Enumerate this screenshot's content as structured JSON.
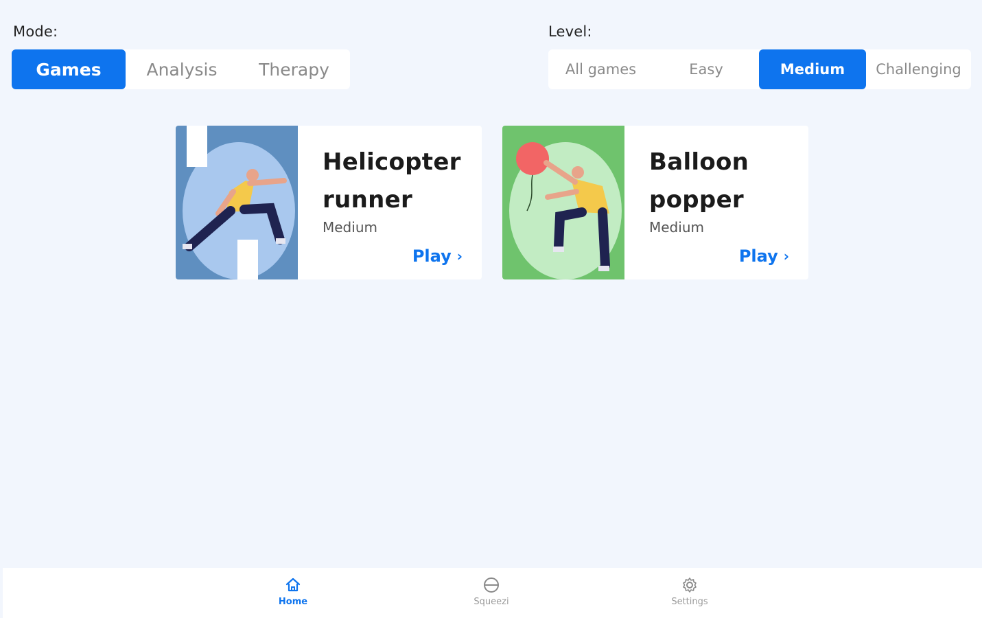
{
  "mode": {
    "label": "Mode:",
    "options": [
      "Games",
      "Analysis",
      "Therapy"
    ],
    "selected": "Games"
  },
  "level": {
    "label": "Level:",
    "options": [
      "All games",
      "Easy",
      "Medium",
      "Challenging"
    ],
    "selected": "Medium"
  },
  "games": [
    {
      "title_line1": "Helicopter",
      "title_line2": "runner",
      "level": "Medium",
      "play_label": "Play",
      "art_bg": "#5f8fc0",
      "art_blob": "#a9c8ee"
    },
    {
      "title_line1": "Balloon",
      "title_line2": "popper",
      "level": "Medium",
      "play_label": "Play",
      "art_bg": "#6fc36d",
      "art_blob": "#c2ecc3"
    }
  ],
  "nav": {
    "items": [
      {
        "label": "Home",
        "icon": "home-icon",
        "active": true
      },
      {
        "label": "Squeezi",
        "icon": "squeezi-icon",
        "active": false
      },
      {
        "label": "Settings",
        "icon": "gear-icon",
        "active": false
      }
    ]
  },
  "colors": {
    "accent": "#0e74ee",
    "background": "#f2f6fd"
  }
}
